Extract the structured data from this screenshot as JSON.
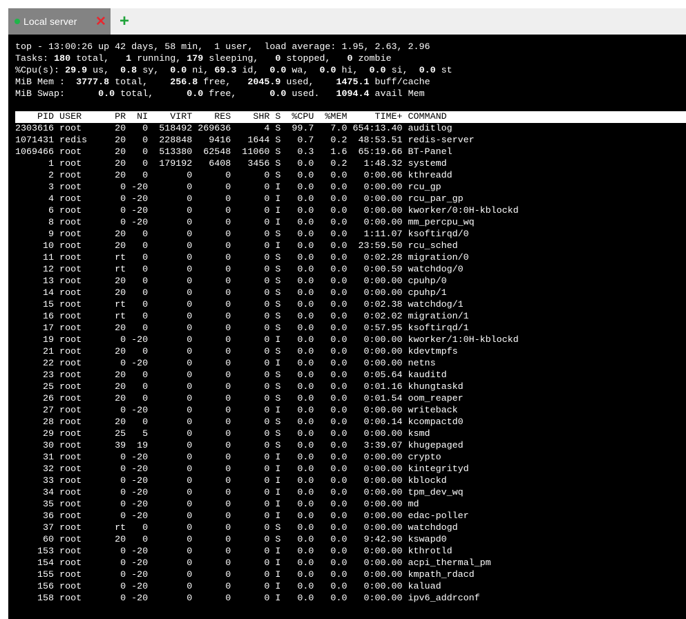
{
  "tab": {
    "title": "Local server",
    "status_color": "#20b54a",
    "close_icon": "close-icon",
    "add_icon": "plus-icon"
  },
  "summary": {
    "top": "top - 13:00:26 up 42 days, 58 min,  1 user,  load average: 1.95, 2.63, 2.96",
    "tasks": [
      {
        "t": "Tasks: ",
        "b": false
      },
      {
        "t": "180",
        "b": true
      },
      {
        "t": " total,   ",
        "b": false
      },
      {
        "t": "1",
        "b": true
      },
      {
        "t": " running, ",
        "b": false
      },
      {
        "t": "179",
        "b": true
      },
      {
        "t": " sleeping,   ",
        "b": false
      },
      {
        "t": "0",
        "b": true
      },
      {
        "t": " stopped,   ",
        "b": false
      },
      {
        "t": "0",
        "b": true
      },
      {
        "t": " zombie",
        "b": false
      }
    ],
    "cpu": [
      {
        "t": "%Cpu(s): ",
        "b": false
      },
      {
        "t": "29.9",
        "b": true
      },
      {
        "t": " us,  ",
        "b": false
      },
      {
        "t": "0.8",
        "b": true
      },
      {
        "t": " sy,  ",
        "b": false
      },
      {
        "t": "0.0",
        "b": true
      },
      {
        "t": " ni, ",
        "b": false
      },
      {
        "t": "69.3",
        "b": true
      },
      {
        "t": " id,  ",
        "b": false
      },
      {
        "t": "0.0",
        "b": true
      },
      {
        "t": " wa,  ",
        "b": false
      },
      {
        "t": "0.0",
        "b": true
      },
      {
        "t": " hi,  ",
        "b": false
      },
      {
        "t": "0.0",
        "b": true
      },
      {
        "t": " si,  ",
        "b": false
      },
      {
        "t": "0.0",
        "b": true
      },
      {
        "t": " st",
        "b": false
      }
    ],
    "mem": [
      {
        "t": "MiB Mem :  ",
        "b": false
      },
      {
        "t": "3777.8",
        "b": true
      },
      {
        "t": " total,    ",
        "b": false
      },
      {
        "t": "256.8",
        "b": true
      },
      {
        "t": " free,   ",
        "b": false
      },
      {
        "t": "2045.9",
        "b": true
      },
      {
        "t": " used,    ",
        "b": false
      },
      {
        "t": "1475.1",
        "b": true
      },
      {
        "t": " buff/cache",
        "b": false
      }
    ],
    "swap": [
      {
        "t": "MiB Swap:      ",
        "b": false
      },
      {
        "t": "0.0",
        "b": true
      },
      {
        "t": " total,      ",
        "b": false
      },
      {
        "t": "0.0",
        "b": true
      },
      {
        "t": " free,      ",
        "b": false
      },
      {
        "t": "0.0",
        "b": true
      },
      {
        "t": " used.   ",
        "b": false
      },
      {
        "t": "1094.4",
        "b": true
      },
      {
        "t": " avail Mem",
        "b": false
      }
    ]
  },
  "columns": "    PID USER      PR  NI    VIRT    RES    SHR S  %CPU  %MEM     TIME+ COMMAND",
  "processes": [
    "2303616 root      20   0  518492 269636      4 S  99.7   7.0 654:13.40 auditlog",
    "1071431 redis     20   0  228848   9416   1644 S   0.7   0.2  48:53.51 redis-server",
    "1069466 root      20   0  513380  62548  11060 S   0.3   1.6  65:19.66 BT-Panel",
    "      1 root      20   0  179192   6408   3456 S   0.0   0.2   1:48.32 systemd",
    "      2 root      20   0       0      0      0 S   0.0   0.0   0:00.06 kthreadd",
    "      3 root       0 -20       0      0      0 I   0.0   0.0   0:00.00 rcu_gp",
    "      4 root       0 -20       0      0      0 I   0.0   0.0   0:00.00 rcu_par_gp",
    "      6 root       0 -20       0      0      0 I   0.0   0.0   0:00.00 kworker/0:0H-kblockd",
    "      8 root       0 -20       0      0      0 I   0.0   0.0   0:00.00 mm_percpu_wq",
    "      9 root      20   0       0      0      0 S   0.0   0.0   1:11.07 ksoftirqd/0",
    "     10 root      20   0       0      0      0 I   0.0   0.0  23:59.50 rcu_sched",
    "     11 root      rt   0       0      0      0 S   0.0   0.0   0:02.28 migration/0",
    "     12 root      rt   0       0      0      0 S   0.0   0.0   0:00.59 watchdog/0",
    "     13 root      20   0       0      0      0 S   0.0   0.0   0:00.00 cpuhp/0",
    "     14 root      20   0       0      0      0 S   0.0   0.0   0:00.00 cpuhp/1",
    "     15 root      rt   0       0      0      0 S   0.0   0.0   0:02.38 watchdog/1",
    "     16 root      rt   0       0      0      0 S   0.0   0.0   0:02.02 migration/1",
    "     17 root      20   0       0      0      0 S   0.0   0.0   0:57.95 ksoftirqd/1",
    "     19 root       0 -20       0      0      0 I   0.0   0.0   0:00.00 kworker/1:0H-kblockd",
    "     21 root      20   0       0      0      0 S   0.0   0.0   0:00.00 kdevtmpfs",
    "     22 root       0 -20       0      0      0 I   0.0   0.0   0:00.00 netns",
    "     23 root      20   0       0      0      0 S   0.0   0.0   0:05.64 kauditd",
    "     25 root      20   0       0      0      0 S   0.0   0.0   0:01.16 khungtaskd",
    "     26 root      20   0       0      0      0 S   0.0   0.0   0:01.54 oom_reaper",
    "     27 root       0 -20       0      0      0 I   0.0   0.0   0:00.00 writeback",
    "     28 root      20   0       0      0      0 S   0.0   0.0   0:00.14 kcompactd0",
    "     29 root      25   5       0      0      0 S   0.0   0.0   0:00.00 ksmd",
    "     30 root      39  19       0      0      0 S   0.0   0.0   3:39.07 khugepaged",
    "     31 root       0 -20       0      0      0 I   0.0   0.0   0:00.00 crypto",
    "     32 root       0 -20       0      0      0 I   0.0   0.0   0:00.00 kintegrityd",
    "     33 root       0 -20       0      0      0 I   0.0   0.0   0:00.00 kblockd",
    "     34 root       0 -20       0      0      0 I   0.0   0.0   0:00.00 tpm_dev_wq",
    "     35 root       0 -20       0      0      0 I   0.0   0.0   0:00.00 md",
    "     36 root       0 -20       0      0      0 I   0.0   0.0   0:00.00 edac-poller",
    "     37 root      rt   0       0      0      0 S   0.0   0.0   0:00.00 watchdogd",
    "     60 root      20   0       0      0      0 S   0.0   0.0   9:42.90 kswapd0",
    "    153 root       0 -20       0      0      0 I   0.0   0.0   0:00.00 kthrotld",
    "    154 root       0 -20       0      0      0 I   0.0   0.0   0:00.00 acpi_thermal_pm",
    "    155 root       0 -20       0      0      0 I   0.0   0.0   0:00.00 kmpath_rdacd",
    "    156 root       0 -20       0      0      0 I   0.0   0.0   0:00.00 kaluad",
    "    158 root       0 -20       0      0      0 I   0.0   0.0   0:00.00 ipv6_addrconf"
  ]
}
